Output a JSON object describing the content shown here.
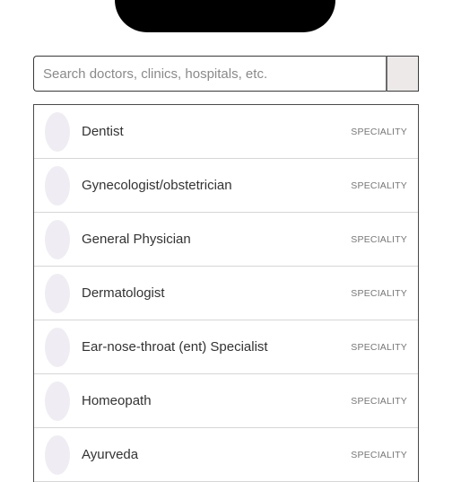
{
  "search": {
    "placeholder": "Search doctors, clinics, hospitals, etc."
  },
  "icons": {
    "avatar": "specialty-avatar-placeholder"
  },
  "results": [
    {
      "label": "Dentist",
      "type": "SPECIALITY"
    },
    {
      "label": "Gynecologist/obstetrician",
      "type": "SPECIALITY"
    },
    {
      "label": "General Physician",
      "type": "SPECIALITY"
    },
    {
      "label": "Dermatologist",
      "type": "SPECIALITY"
    },
    {
      "label": "Ear-nose-throat (ent) Specialist",
      "type": "SPECIALITY"
    },
    {
      "label": "Homeopath",
      "type": "SPECIALITY"
    },
    {
      "label": "Ayurveda",
      "type": "SPECIALITY"
    }
  ]
}
